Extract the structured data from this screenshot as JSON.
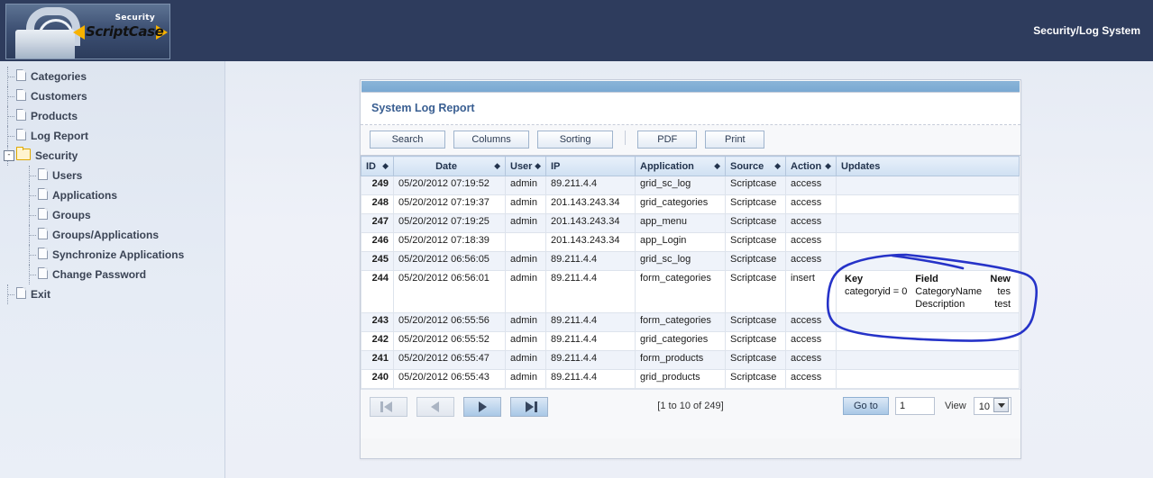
{
  "header": {
    "logo_brand": "ScriptCase",
    "logo_sub": "Security",
    "app_title": "Security/Log System"
  },
  "sidebar": {
    "items": [
      {
        "label": "Categories",
        "icon": "document-icon",
        "level": 0,
        "expandable": false
      },
      {
        "label": "Customers",
        "icon": "document-icon",
        "level": 0,
        "expandable": false
      },
      {
        "label": "Products",
        "icon": "document-icon",
        "level": 0,
        "expandable": false
      },
      {
        "label": "Log Report",
        "icon": "document-icon",
        "level": 0,
        "expandable": false
      },
      {
        "label": "Security",
        "icon": "folder-icon",
        "level": 0,
        "expandable": true,
        "expander": "-"
      },
      {
        "label": "Users",
        "icon": "document-icon",
        "level": 1,
        "expandable": false
      },
      {
        "label": "Applications",
        "icon": "document-icon",
        "level": 1,
        "expandable": false
      },
      {
        "label": "Groups",
        "icon": "document-icon",
        "level": 1,
        "expandable": false
      },
      {
        "label": "Groups/Applications",
        "icon": "document-icon",
        "level": 1,
        "expandable": false
      },
      {
        "label": "Synchronize Applications",
        "icon": "document-icon",
        "level": 1,
        "expandable": false
      },
      {
        "label": "Change Password",
        "icon": "document-icon",
        "level": 1,
        "expandable": false
      },
      {
        "label": "Exit",
        "icon": "document-icon",
        "level": 0,
        "expandable": false
      }
    ]
  },
  "report": {
    "title": "System Log Report",
    "toolbar": {
      "search": "Search",
      "columns": "Columns",
      "sorting": "Sorting",
      "pdf": "PDF",
      "print": "Print"
    },
    "columns": [
      {
        "label": "ID",
        "sortable": true,
        "align": "left"
      },
      {
        "label": "Date",
        "sortable": true,
        "align": "center"
      },
      {
        "label": "User",
        "sortable": true,
        "align": "left"
      },
      {
        "label": "IP",
        "sortable": false,
        "align": "left"
      },
      {
        "label": "Application",
        "sortable": true,
        "align": "left"
      },
      {
        "label": "Source",
        "sortable": true,
        "align": "left"
      },
      {
        "label": "Action",
        "sortable": true,
        "align": "left"
      },
      {
        "label": "Updates",
        "sortable": false,
        "align": "left"
      }
    ],
    "rows": [
      {
        "id": "249",
        "date": "05/20/2012 07:19:52",
        "user": "admin",
        "ip": "89.211.4.4",
        "application": "grid_sc_log",
        "source": "Scriptcase",
        "action": "access",
        "updates": null
      },
      {
        "id": "248",
        "date": "05/20/2012 07:19:37",
        "user": "admin",
        "ip": "201.143.243.34",
        "application": "grid_categories",
        "source": "Scriptcase",
        "action": "access",
        "updates": null
      },
      {
        "id": "247",
        "date": "05/20/2012 07:19:25",
        "user": "admin",
        "ip": "201.143.243.34",
        "application": "app_menu",
        "source": "Scriptcase",
        "action": "access",
        "updates": null
      },
      {
        "id": "246",
        "date": "05/20/2012 07:18:39",
        "user": "",
        "ip": "201.143.243.34",
        "application": "app_Login",
        "source": "Scriptcase",
        "action": "access",
        "updates": null
      },
      {
        "id": "245",
        "date": "05/20/2012 06:56:05",
        "user": "admin",
        "ip": "89.211.4.4",
        "application": "grid_sc_log",
        "source": "Scriptcase",
        "action": "access",
        "updates": null
      },
      {
        "id": "244",
        "date": "05/20/2012 06:56:01",
        "user": "admin",
        "ip": "89.211.4.4",
        "application": "form_categories",
        "source": "Scriptcase",
        "action": "insert",
        "updates": {
          "headers": [
            "Key",
            "Field",
            "New"
          ],
          "rows": [
            [
              "categoryid = 0",
              "CategoryName",
              "tes"
            ],
            [
              "",
              "Description",
              "test"
            ]
          ]
        }
      },
      {
        "id": "243",
        "date": "05/20/2012 06:55:56",
        "user": "admin",
        "ip": "89.211.4.4",
        "application": "form_categories",
        "source": "Scriptcase",
        "action": "access",
        "updates": null
      },
      {
        "id": "242",
        "date": "05/20/2012 06:55:52",
        "user": "admin",
        "ip": "89.211.4.4",
        "application": "grid_categories",
        "source": "Scriptcase",
        "action": "access",
        "updates": null
      },
      {
        "id": "241",
        "date": "05/20/2012 06:55:47",
        "user": "admin",
        "ip": "89.211.4.4",
        "application": "form_products",
        "source": "Scriptcase",
        "action": "access",
        "updates": null
      },
      {
        "id": "240",
        "date": "05/20/2012 06:55:43",
        "user": "admin",
        "ip": "89.211.4.4",
        "application": "grid_products",
        "source": "Scriptcase",
        "action": "access",
        "updates": null
      }
    ],
    "pagination": {
      "first_icon": "first-page-icon",
      "prev_icon": "previous-page-icon",
      "next_icon": "next-page-icon",
      "last_icon": "last-page-icon",
      "info": "[1 to 10 of 249]",
      "goto_label": "Go to",
      "page_value": "1",
      "view_label": "View",
      "view_value": "10"
    }
  },
  "annotation": {
    "shape": "hand-drawn-ellipse",
    "color": "#2633c8"
  }
}
